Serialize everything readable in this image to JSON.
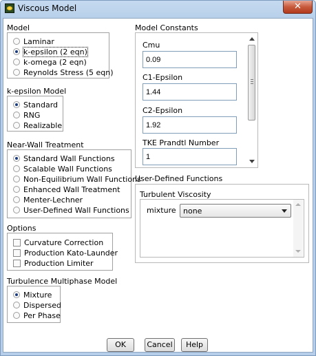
{
  "window": {
    "title": "Viscous Model",
    "close_label": "✕"
  },
  "model": {
    "title": "Model",
    "options": [
      {
        "label": "Laminar",
        "selected": false
      },
      {
        "label": "k-epsilon (2 eqn)",
        "selected": true
      },
      {
        "label": "k-omega (2 eqn)",
        "selected": false
      },
      {
        "label": "Reynolds Stress (5 eqn)",
        "selected": false
      }
    ]
  },
  "kepsilon_model": {
    "title": "k-epsilon Model",
    "options": [
      {
        "label": "Standard",
        "selected": true
      },
      {
        "label": "RNG",
        "selected": false
      },
      {
        "label": "Realizable",
        "selected": false
      }
    ]
  },
  "near_wall": {
    "title": "Near-Wall Treatment",
    "options": [
      {
        "label": "Standard Wall Functions",
        "selected": true
      },
      {
        "label": "Scalable Wall Functions",
        "selected": false
      },
      {
        "label": "Non-Equilibrium Wall Functions",
        "selected": false
      },
      {
        "label": "Enhanced Wall Treatment",
        "selected": false
      },
      {
        "label": "Menter-Lechner",
        "selected": false
      },
      {
        "label": "User-Defined Wall Functions",
        "selected": false
      }
    ]
  },
  "options_group": {
    "title": "Options",
    "items": [
      {
        "label": "Curvature Correction",
        "checked": false
      },
      {
        "label": "Production Kato-Launder",
        "checked": false
      },
      {
        "label": "Production Limiter",
        "checked": false
      }
    ]
  },
  "multiphase": {
    "title": "Turbulence Multiphase Model",
    "options": [
      {
        "label": "Mixture",
        "selected": true
      },
      {
        "label": "Dispersed",
        "selected": false
      },
      {
        "label": "Per Phase",
        "selected": false
      }
    ]
  },
  "model_constants": {
    "title": "Model Constants",
    "items": [
      {
        "label": "Cmu",
        "value": "0.09"
      },
      {
        "label": "C1-Epsilon",
        "value": "1.44"
      },
      {
        "label": "C2-Epsilon",
        "value": "1.92"
      },
      {
        "label": "TKE Prandtl Number",
        "value": "1"
      }
    ]
  },
  "udf": {
    "title": "User-Defined Functions",
    "turbulent_viscosity": {
      "title": "Turbulent Viscosity",
      "phase_label": "mixture",
      "selected": "none"
    }
  },
  "buttons": {
    "ok": "OK",
    "cancel": "Cancel",
    "help": "Help"
  }
}
